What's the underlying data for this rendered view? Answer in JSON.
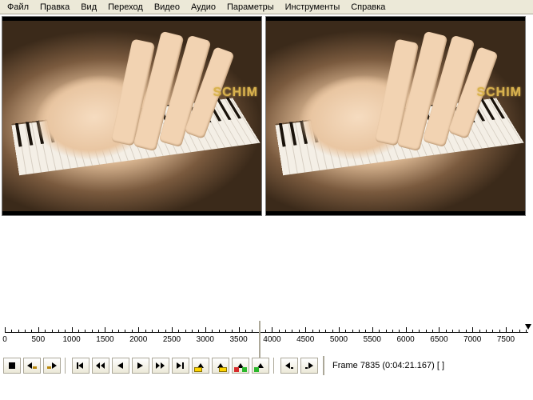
{
  "menu": [
    "Файл",
    "Правка",
    "Вид",
    "Переход",
    "Видео",
    "Аудио",
    "Параметры",
    "Инструменты",
    "Справка"
  ],
  "brand_text": "SCHIM",
  "timeline": {
    "ticks": [
      0,
      500,
      1000,
      1500,
      2000,
      2500,
      3000,
      3500,
      4000,
      4500,
      5000,
      5500,
      6000,
      6500,
      7000,
      7500
    ],
    "max": 7835,
    "divider_at": 3800
  },
  "status": {
    "text": "Frame 7835 (0:04:21.167) [ ]"
  },
  "toolbar_icons": [
    "stop",
    "go-start-sel",
    "go-end-sel",
    "sep",
    "go-first",
    "step-back",
    "play-back",
    "play-fwd",
    "step-fwd",
    "go-last",
    "mark-in",
    "mark-out",
    "mark-range-in",
    "mark-range-out",
    "sep",
    "shift-left",
    "shift-right",
    "vsep"
  ]
}
